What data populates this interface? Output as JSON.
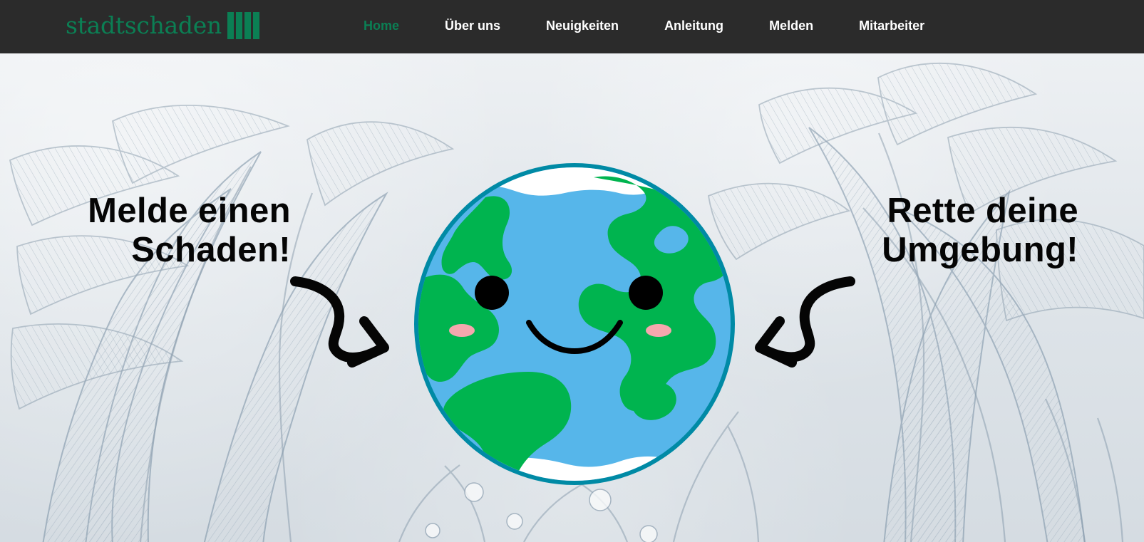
{
  "header": {
    "brand": "stadtschaden",
    "nav": [
      {
        "label": "Home",
        "active": true
      },
      {
        "label": "Über uns",
        "active": false
      },
      {
        "label": "Neuigkeiten",
        "active": false
      },
      {
        "label": "Anleitung",
        "active": false
      },
      {
        "label": "Melden",
        "active": false
      },
      {
        "label": "Mitarbeiter",
        "active": false
      }
    ]
  },
  "hero": {
    "left_line_1": "Melde einen",
    "left_line_2": "Schaden!",
    "right_line_1": "Rette deine",
    "right_line_2": "Umgebung!"
  },
  "colors": {
    "header_bg": "#2b2b2b",
    "accent": "#0b7f54",
    "text_dark": "#050505",
    "globe_ocean": "#56b6ea",
    "globe_land": "#00b44f",
    "globe_outline": "#008aa5"
  },
  "icons": {
    "brand_mark": "vertical-bars-logo",
    "left_arrow": "curved-arrow-right-icon",
    "right_arrow": "curved-arrow-left-icon",
    "globe": "smiling-earth-illustration"
  }
}
